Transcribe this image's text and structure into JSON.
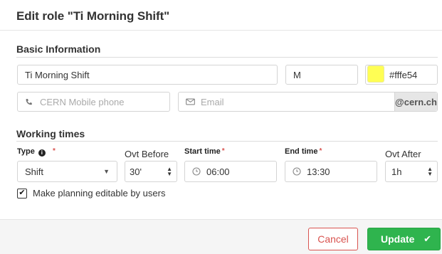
{
  "dialog": {
    "title": "Edit role \"Ti Morning Shift\""
  },
  "basic": {
    "section_title": "Basic Information",
    "name_value": "Ti Morning Shift",
    "abbrev_value": "M",
    "color_value": "#fffe54",
    "phone_placeholder": "CERN Mobile phone",
    "email_placeholder": "Email",
    "email_suffix": "@cern.ch"
  },
  "working": {
    "section_title": "Working times",
    "type_label": "Type",
    "type_value": "Shift",
    "ovt_before_label": "Ovt Before",
    "ovt_before_value": "30'",
    "start_label": "Start time",
    "start_value": "06:00",
    "end_label": "End time",
    "end_value": "13:30",
    "ovt_after_label": "Ovt After",
    "ovt_after_value": "1h",
    "required_mark": "*"
  },
  "options": {
    "editable_label": "Make planning editable by users",
    "editable_checked": true
  },
  "footer": {
    "cancel_label": "Cancel",
    "update_label": "Update"
  },
  "icons": {
    "phone": "phone-icon",
    "email": "envelope-icon",
    "info": "info-circle-icon",
    "clock": "clock-icon",
    "check": "check-icon",
    "caret": "caret-down-icon",
    "updown": "updown-icon"
  },
  "colors": {
    "accent_green": "#2fb44e",
    "danger_red": "#d9534f",
    "swatch": "#fffe54"
  }
}
